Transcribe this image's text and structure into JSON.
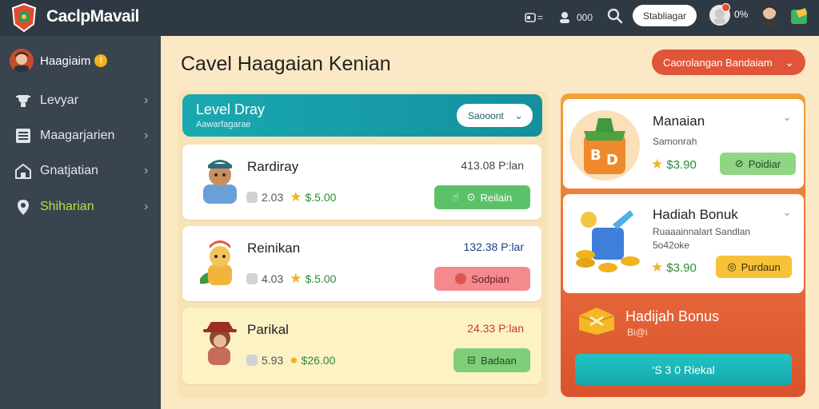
{
  "header": {
    "app_title": "CaclpMavail",
    "stat_a": "=",
    "stat_b": "000",
    "button_label": "Stabliagar",
    "counter": "0%"
  },
  "sidebar": {
    "user_name": "Haagiaim",
    "coin_symbol": "!",
    "items": [
      {
        "label": "Levyar",
        "icon": "trophy-icon"
      },
      {
        "label": "Maagarjarien",
        "icon": "list-icon"
      },
      {
        "label": "Gnatjatian",
        "icon": "home-icon"
      },
      {
        "label": "Shiharian",
        "icon": "location-pin-icon",
        "active": true
      }
    ]
  },
  "main": {
    "title": "Cavel Haagaian Kenian",
    "dropdown_label": "Caorolangan Bandaiam"
  },
  "level_panel": {
    "title": "Level Dray",
    "subtitle": "Aawarfagarae",
    "select_label": "Saooont",
    "cards": [
      {
        "name": "Rardiray",
        "level": "2.03",
        "price": "$.5.00",
        "amount": "413.08 P:lan",
        "amount_color": "#444444",
        "action": "Reilain",
        "action_color": "#5cc26a"
      },
      {
        "name": "Reinikan",
        "level": "4.03",
        "price": "$.5.00",
        "amount": "132.38 P:lar",
        "amount_color": "#1d3e8a",
        "action": "Sodpian",
        "action_color": "#f48a8e"
      },
      {
        "name": "Parikal",
        "level": "5.93",
        "price": "$26.00",
        "amount": "24.33 P:lan",
        "amount_color": "#c63b2a",
        "action": "Badaan",
        "action_color": "#7fcf7a"
      }
    ]
  },
  "offers_panel": {
    "cards": [
      {
        "title": "Manaian",
        "subtitle": "Samonrah",
        "price": "$3.90",
        "action": "Poidiar",
        "action_color": "#8fd583",
        "action_text_color": "#1d4e23"
      },
      {
        "title": "Hadiah Bonuk",
        "subtitle": "Ruaaainnalart Sandlan",
        "subtitle2": "5o42oke",
        "price": "$3.90",
        "action": "Purdaun",
        "action_color": "#f7c23a",
        "action_text_color": "#3c2e08"
      }
    ],
    "bonus": {
      "title": "Hadijah Bonus",
      "subtitle": "Bi@i",
      "button": "‘S 3 0 Riekal"
    }
  },
  "colors": {
    "topbar": "#2f3944",
    "sidebar": "#3a444f",
    "accent_teal": "#1aa9b1",
    "accent_orange": "#e0553a",
    "active_green": "#b3e04b"
  }
}
